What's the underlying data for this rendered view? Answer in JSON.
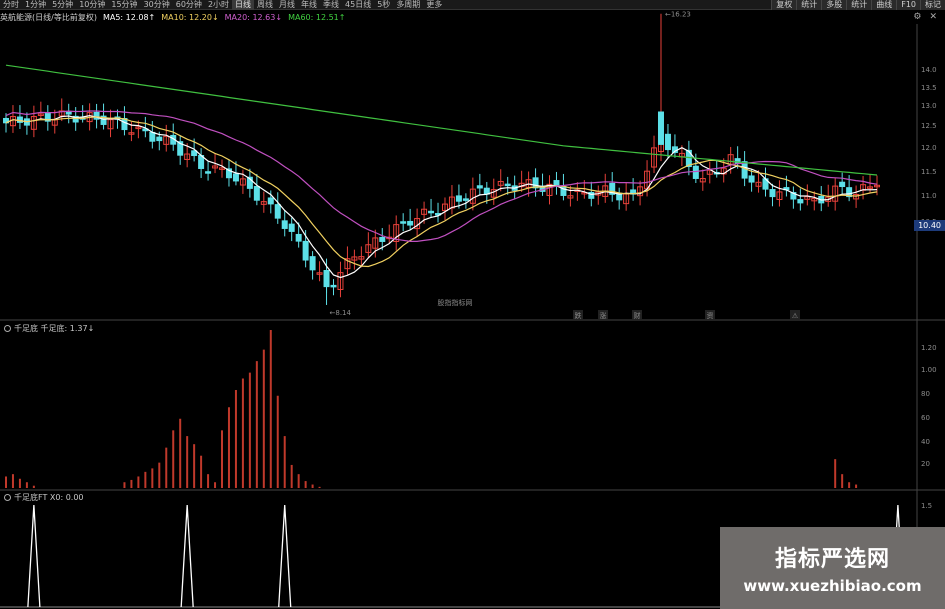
{
  "toolbar": {
    "timeframes": [
      "分时",
      "1分钟",
      "5分钟",
      "10分钟",
      "15分钟",
      "30分钟",
      "60分钟",
      "2小时",
      "日线",
      "周线",
      "月线",
      "年线",
      "季线",
      "45日线",
      "5秒",
      "多周期",
      "更多"
    ],
    "active_index": 8,
    "right_buttons": [
      "复权",
      "统计",
      "多股",
      "统计",
      "曲线",
      "F10",
      "标记"
    ]
  },
  "info": {
    "title": "英航能源(日线/等比前复权)",
    "ma5": "MA5: 12.08↑",
    "ma10": "MA10: 12.20↓",
    "ma20": "MA20: 12.63↓",
    "ma60": "MA60: 12.51↑"
  },
  "price_axis": [
    "14.0",
    "13.5",
    "13.0",
    "12.5",
    "12.0",
    "11.5",
    "11.0",
    "10.5"
  ],
  "price_tag": "10.40",
  "annotations": {
    "high": "16.23",
    "low": "8.14",
    "center_watermark": "股指指标网",
    "tags": [
      "跌",
      "涨",
      "财",
      "资",
      "⚠"
    ]
  },
  "panel1": {
    "label": "千足底  千足底: 1.37↓",
    "axis": [
      "1.20",
      "1.00",
      "80",
      "60",
      "40",
      "20"
    ]
  },
  "panel2": {
    "label": "千足底FT  X0: 0.00",
    "axis": [
      "1.5",
      "1.0",
      "0.5"
    ]
  },
  "watermark": {
    "title": "指标严选网",
    "url": "www.xuezhibiao.com"
  },
  "colors": {
    "up": "#e8413a",
    "down": "#5ce0e8",
    "ma5": "#ffffff",
    "ma10": "#f0d060",
    "ma20": "#c050c0",
    "ma60": "#40c040",
    "bar": "#c0392b",
    "spike": "#ffffff"
  },
  "chart_data": {
    "type": "line",
    "description_values": {
      "high": 16.23,
      "low": 8.14
    },
    "panel1_values": [
      0.1,
      0.12,
      0.08,
      0.05,
      0.02,
      0,
      0,
      0,
      0,
      0,
      0,
      0,
      0,
      0,
      0,
      0,
      0,
      0.05,
      0.07,
      0.1,
      0.14,
      0.17,
      0.22,
      0.35,
      0.5,
      0.6,
      0.45,
      0.38,
      0.28,
      0.12,
      0.05,
      0.5,
      0.7,
      0.85,
      0.95,
      1.0,
      1.1,
      1.2,
      1.37,
      0.8,
      0.45,
      0.2,
      0.12,
      0.06,
      0.03,
      0.01,
      0,
      0,
      0,
      0,
      0,
      0,
      0,
      0,
      0,
      0,
      0,
      0,
      0,
      0,
      0,
      0,
      0,
      0,
      0,
      0,
      0,
      0,
      0,
      0,
      0,
      0,
      0,
      0,
      0,
      0,
      0,
      0,
      0,
      0,
      0,
      0,
      0,
      0,
      0,
      0,
      0,
      0,
      0,
      0,
      0,
      0,
      0,
      0,
      0,
      0,
      0,
      0,
      0,
      0,
      0,
      0,
      0,
      0,
      0,
      0,
      0,
      0,
      0,
      0,
      0,
      0,
      0,
      0,
      0,
      0,
      0,
      0,
      0,
      0.25,
      0.12,
      0.05,
      0.03
    ],
    "panel2_spikes": [
      4,
      26,
      40,
      128
    ]
  }
}
